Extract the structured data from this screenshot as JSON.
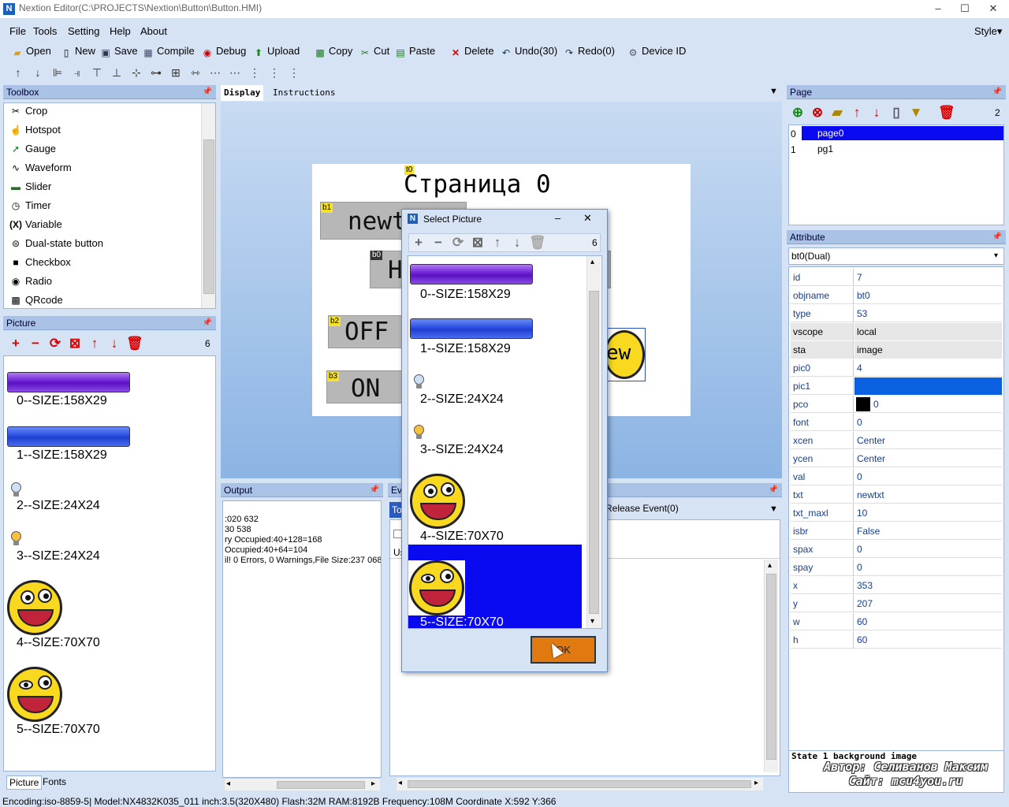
{
  "window": {
    "title": "Nextion Editor(C:\\PROJECTS\\Nextion\\Button\\Button.HMI)",
    "min": "–",
    "max": "☐",
    "close": "✕"
  },
  "menu": {
    "file": "File",
    "tools": "Tools",
    "setting": "Setting",
    "help": "Help",
    "about": "About",
    "style": "Style▾"
  },
  "toolbar": {
    "open": "Open",
    "new": "New",
    "save": "Save",
    "compile": "Compile",
    "debug": "Debug",
    "upload": "Upload",
    "copy": "Copy",
    "cut": "Cut",
    "paste": "Paste",
    "delete": "Delete",
    "undo": "Undo(30)",
    "redo": "Redo(0)",
    "device": "Device  ID"
  },
  "toolbox": {
    "title": "Toolbox",
    "items": [
      "Crop",
      "Hotspot",
      "Gauge",
      "Waveform",
      "Slider",
      "Timer",
      "Variable",
      "Dual-state button",
      "Checkbox",
      "Radio",
      "QRcode"
    ]
  },
  "picture_panel": {
    "title": "Picture",
    "count": "6",
    "labels": [
      "0--SIZE:158X29",
      "1--SIZE:158X29",
      "2--SIZE:24X24",
      "3--SIZE:24X24",
      "4--SIZE:70X70",
      "5--SIZE:70X70"
    ],
    "tabs": [
      "Picture",
      "Fonts"
    ]
  },
  "display": {
    "tab_display": "Display",
    "tab_instructions": "Instructions",
    "canvas_title": "Страница 0",
    "t0": "t0",
    "b1_tag": "b1",
    "b1_text": "newt",
    "b0_tag": "b0",
    "b0_text": "H",
    "b2_tag": "b2",
    "b2_text": "OFF",
    "b3_tag": "b3",
    "b3_text": "ON",
    "bt0_text": "ew"
  },
  "output": {
    "title": "Output",
    "lines": [
      ":020 632",
      "30 538",
      "ry Occupied:40+128=168",
      "Occupied:40+64=104",
      "il! 0 Errors, 0 Warnings,File Size:237 068"
    ]
  },
  "event": {
    "title": "Eve",
    "tab": "To",
    "release": "Release Event(0)",
    "user": "Us"
  },
  "page_panel": {
    "title": "Page",
    "count": "2",
    "pages": [
      {
        "idx": "0",
        "name": "page0"
      },
      {
        "idx": "1",
        "name": "pg1"
      }
    ]
  },
  "attribute": {
    "title": "Attribute",
    "selector": "bt0(Dual)",
    "rows": [
      {
        "k": "id",
        "v": "7"
      },
      {
        "k": "objname",
        "v": "bt0"
      },
      {
        "k": "type",
        "v": "53"
      },
      {
        "k": "vscope",
        "v": "local"
      },
      {
        "k": "sta",
        "v": "image"
      },
      {
        "k": "pic0",
        "v": "4"
      },
      {
        "k": "pic1",
        "v": ""
      },
      {
        "k": "pco",
        "v": "0"
      },
      {
        "k": "font",
        "v": "0"
      },
      {
        "k": "xcen",
        "v": "Center"
      },
      {
        "k": "ycen",
        "v": "Center"
      },
      {
        "k": "val",
        "v": "0"
      },
      {
        "k": "txt",
        "v": "newtxt"
      },
      {
        "k": "txt_maxl",
        "v": "10"
      },
      {
        "k": "isbr",
        "v": "False"
      },
      {
        "k": "spax",
        "v": "0"
      },
      {
        "k": "spay",
        "v": "0"
      },
      {
        "k": "x",
        "v": "353"
      },
      {
        "k": "y",
        "v": "207"
      },
      {
        "k": "w",
        "v": "60"
      },
      {
        "k": "h",
        "v": "60"
      }
    ],
    "help": "State 1 background image"
  },
  "watermark": {
    "line1": "Автор: Селиванов Максим",
    "line2": "Сайт: mcu4you.ru"
  },
  "dialog": {
    "title": "Select Picture",
    "count": "6",
    "labels": [
      "0--SIZE:158X29",
      "1--SIZE:158X29",
      "2--SIZE:24X24",
      "3--SIZE:24X24",
      "4--SIZE:70X70",
      "5--SIZE:70X70"
    ],
    "ok": "OK"
  },
  "status": "Encoding:iso-8859-5| Model:NX4832K035_011  inch:3.5(320X480) Flash:32M RAM:8192B Frequency:108M    Coordinate X:592  Y:366"
}
